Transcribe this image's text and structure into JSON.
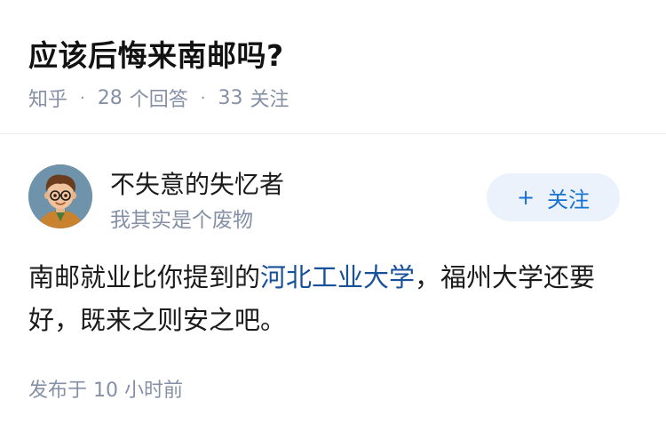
{
  "question": {
    "title": "应该后悔来南邮吗?",
    "source": "知乎",
    "answers_count": "28",
    "answers_label": "个回答",
    "followers_count": "33",
    "followers_label": "关注"
  },
  "author": {
    "name": "不失意的失忆者",
    "bio": "我其实是个废物",
    "avatar_icon": "cartoon-avatar-icon",
    "follow_plus": "+",
    "follow_label": "关注"
  },
  "answer": {
    "text_before_link": "南邮就业比你提到的",
    "link_text": "河北工业大学",
    "text_after_link": "，福州大学还要好，既来之则安之吧。",
    "time_prefix": "发布于",
    "time_value": "10 小时前"
  },
  "colors": {
    "accent": "#1772d3",
    "link": "#175199",
    "muted": "#8590a6",
    "follow_bg": "#ebf2fb"
  }
}
